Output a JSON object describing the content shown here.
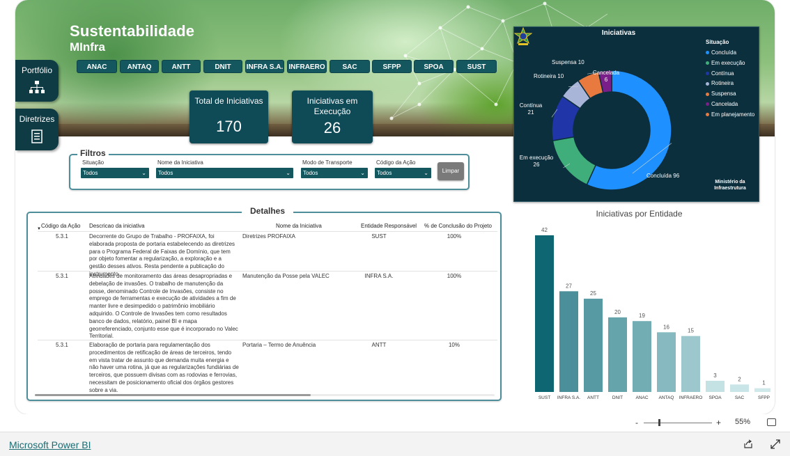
{
  "header": {
    "title_line1": "Sustentabilidade",
    "title_line2": "MInfra"
  },
  "entity_buttons": [
    "ANAC",
    "ANTAQ",
    "ANTT",
    "DNIT",
    "INFRA S.A.",
    "INFRAERO",
    "SAC",
    "SFPP",
    "SPOA",
    "SUST"
  ],
  "side_nav": {
    "portfolio_label": "Portfólio",
    "portfolio_icon": "org-chart-icon",
    "diretrizes_label": "Diretrizes",
    "diretrizes_icon": "document-icon"
  },
  "kpis": {
    "total_label": "Total de Iniciativas",
    "total_value": "170",
    "exec_label": "Iniciativas em Execução",
    "exec_value": "26"
  },
  "filters": {
    "title": "Filtros",
    "situacao_label": "Situação",
    "situacao_value": "Todos",
    "nome_label": "Nome da Iniciativa",
    "nome_value": "Todos",
    "modo_label": "Modo de Transporte",
    "modo_value": "Todos",
    "codigo_label": "Código da Ação",
    "codigo_value": "Todos",
    "clear_label": "Limpar"
  },
  "details": {
    "title": "Detalhes",
    "columns": [
      "Código da Ação",
      "Descricao da iniciativa",
      "Nome da Iniciativa",
      "Entidade Responsável",
      "% de Conclusão do Projeto"
    ],
    "rows": [
      {
        "codigo": "5.3.1",
        "descricao": "Decorrente do Grupo de Trabalho - PROFAIXA, foi elaborada proposta de portaria estabelecendo as diretrizes para o Programa Federal de Faixas de Domínio, que tem por objeto fomentar a regularização, a exploração e a gestão desses ativos. Resta pendente a publicação do instrumento.",
        "nome": "Diretrizes PROFAIXA",
        "entidade": "SUST",
        "conclusao": "100%"
      },
      {
        "codigo": "5.3.1",
        "descricao": "Atividades de monitoramento das áreas desapropriadas e debelação de invasões. O trabalho de manutenção da posse, denominado Controle de Invasões, consiste no emprego de ferramentas e execução de atividades a fim de manter livre e desimpedido o patrimônio imobiliário adquirido. O Controle de Invasões tem como resultados banco de dados, relatório, painel BI e mapa georreferenciado, conjunto esse que é incorporado no Valec Territorial.",
        "nome": "Manutenção da Posse pela VALEC",
        "entidade": "INFRA S.A.",
        "conclusao": "100%"
      },
      {
        "codigo": "5.3.1",
        "descricao": "Elaboração de portaria para regulamentação dos procedimentos de retificação de áreas de terceiros, tendo em vista tratar de assunto que demanda muita energia e não haver uma rotina, já que as regularizações fundiárias de terceiros, que possuem divisas com as rodovias e ferrovias, necessitam de posicionamento oficial dos órgãos gestores sobre a via.",
        "nome": "Portaria – Termo de Anuência",
        "entidade": "ANTT",
        "conclusao": "10%"
      }
    ]
  },
  "donut": {
    "title": "Iniciativas",
    "legend_title": "Situação",
    "legend": [
      {
        "label": "Concluída",
        "color": "#1e90ff"
      },
      {
        "label": "Em execução",
        "color": "#3fae7a"
      },
      {
        "label": "Contínua",
        "color": "#1f35a8"
      },
      {
        "label": "Rotineira",
        "color": "#a9b4d9"
      },
      {
        "label": "Suspensa",
        "color": "#e8793f"
      },
      {
        "label": "Cancelada",
        "color": "#7a1e8a"
      },
      {
        "label": "Em planejamento",
        "color": "#e8793f"
      }
    ],
    "ministry_line1": "Ministério da",
    "ministry_line2": "Infraestrutura",
    "crest_icon": "brazil-coat-of-arms-icon"
  },
  "chart_data": [
    {
      "type": "pie",
      "title": "Iniciativas",
      "legend_title": "Situação",
      "categories": [
        "Concluída",
        "Em execução",
        "Contínua",
        "Rotineira",
        "Suspensa",
        "Cancelada"
      ],
      "values": [
        96,
        26,
        21,
        10,
        10,
        6
      ],
      "colors": [
        "#1e90ff",
        "#3fae7a",
        "#1f35a8",
        "#a9b4d9",
        "#e8793f",
        "#7a1e8a"
      ],
      "data_labels": [
        "Concluída 96",
        "Em execução 26",
        "Contínua 21",
        "Rotineira 10",
        "Suspensa 10",
        "Cancelada 6"
      ],
      "legend_position": "right"
    },
    {
      "type": "bar",
      "title": "Iniciativas por Entidade",
      "categories": [
        "SUST",
        "INFRA S.A.",
        "ANTT",
        "DNIT",
        "ANAC",
        "ANTAQ",
        "INFRAERO",
        "SPOA",
        "SAC",
        "SFPP"
      ],
      "values": [
        42,
        27,
        25,
        20,
        19,
        16,
        15,
        3,
        2,
        1
      ],
      "colors": [
        "#0f6673",
        "#4a8f99",
        "#579aa3",
        "#66a4ac",
        "#73adb4",
        "#86bac0",
        "#9cc8cd",
        "#c4e2e4",
        "#c9e5e7",
        "#cfe8ea"
      ],
      "ylim": [
        0,
        42
      ]
    }
  ],
  "zoom": {
    "minus": "-",
    "plus": "+",
    "value": "55%",
    "fit_icon": "fit-to-page-icon"
  },
  "footer": {
    "brand": "Microsoft Power BI",
    "share_icon": "share-icon",
    "expand_icon": "expand-icon"
  }
}
